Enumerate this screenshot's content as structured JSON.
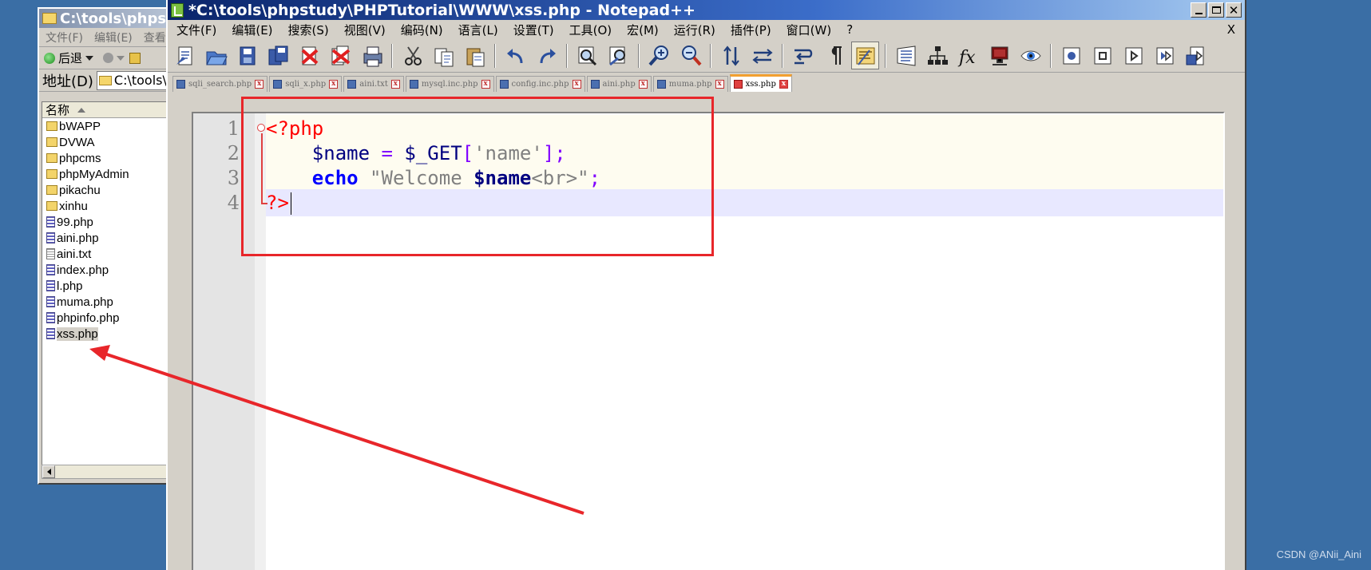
{
  "explorer": {
    "title": "C:\\tools\\phpstudy\\PHPTutorial\\WWW",
    "menu": [
      "文件(F)",
      "编辑(E)",
      "查看(V)"
    ],
    "nav": {
      "back_label": "后退"
    },
    "address": {
      "label": "地址(D)",
      "value": "C:\\tools\\phpstudy\\PHPTutorial\\WWW"
    },
    "column_header": "名称",
    "files": [
      {
        "name": "bWAPP",
        "type": "folder"
      },
      {
        "name": "DVWA",
        "type": "folder"
      },
      {
        "name": "phpcms",
        "type": "folder"
      },
      {
        "name": "phpMyAdmin",
        "type": "folder"
      },
      {
        "name": "pikachu",
        "type": "folder"
      },
      {
        "name": "xinhu",
        "type": "folder"
      },
      {
        "name": "99.php",
        "type": "php"
      },
      {
        "name": "aini.php",
        "type": "php"
      },
      {
        "name": "aini.txt",
        "type": "txt"
      },
      {
        "name": "index.php",
        "type": "php"
      },
      {
        "name": "l.php",
        "type": "php"
      },
      {
        "name": "muma.php",
        "type": "php"
      },
      {
        "name": "phpinfo.php",
        "type": "php"
      },
      {
        "name": "xss.php",
        "type": "php",
        "selected": true
      }
    ]
  },
  "notepad": {
    "title": "*C:\\tools\\phpstudy\\PHPTutorial\\WWW\\xss.php - Notepad++",
    "menu": [
      "文件(F)",
      "编辑(E)",
      "搜索(S)",
      "视图(V)",
      "编码(N)",
      "语言(L)",
      "设置(T)",
      "工具(O)",
      "宏(M)",
      "运行(R)",
      "插件(P)",
      "窗口(W)",
      "?"
    ],
    "menu_close": "X",
    "toolbar_icons": [
      "new-file-icon",
      "open-file-icon",
      "save-icon",
      "save-all-icon",
      "close-icon",
      "close-all-icon",
      "print-icon",
      "cut-icon",
      "copy-icon",
      "paste-icon",
      "undo-icon",
      "redo-icon",
      "find-icon",
      "replace-icon",
      "zoom-in-icon",
      "zoom-out-icon",
      "sync-vertical-icon",
      "sync-horizontal-icon",
      "word-wrap-icon",
      "show-all-chars-icon",
      "indent-guide-icon",
      "document-map-icon",
      "function-list-icon",
      "fx-icon",
      "monitor-icon",
      "eye-icon",
      "record-macro-icon",
      "stop-macro-icon",
      "play-macro-icon",
      "run-macro-multiple-icon",
      "save-macro-icon"
    ],
    "tabs": [
      {
        "label": "sqli_search.php",
        "active": false
      },
      {
        "label": "sqli_x.php",
        "active": false
      },
      {
        "label": "aini.txt",
        "active": false
      },
      {
        "label": "mysql.inc.php",
        "active": false
      },
      {
        "label": "config.inc.php",
        "active": false
      },
      {
        "label": "aini.php",
        "active": false
      },
      {
        "label": "muma.php",
        "active": false
      },
      {
        "label": "xss.php",
        "active": true
      }
    ],
    "code_lines": [
      {
        "num": "1",
        "tokens": [
          {
            "t": "<?php",
            "c": "tag"
          }
        ]
      },
      {
        "num": "2",
        "tokens": [
          {
            "t": "    ",
            "c": "plain"
          },
          {
            "t": "$name",
            "c": "var"
          },
          {
            "t": " ",
            "c": "plain"
          },
          {
            "t": "=",
            "c": "op"
          },
          {
            "t": " ",
            "c": "plain"
          },
          {
            "t": "$_GET",
            "c": "var"
          },
          {
            "t": "[",
            "c": "op"
          },
          {
            "t": "'name'",
            "c": "str"
          },
          {
            "t": "];",
            "c": "op"
          }
        ]
      },
      {
        "num": "3",
        "tokens": [
          {
            "t": "    ",
            "c": "plain"
          },
          {
            "t": "echo",
            "c": "kw"
          },
          {
            "t": " ",
            "c": "plain"
          },
          {
            "t": "\"Welcome ",
            "c": "str"
          },
          {
            "t": "$name",
            "c": "strvar"
          },
          {
            "t": "<br>\"",
            "c": "str"
          },
          {
            "t": ";",
            "c": "op"
          }
        ]
      },
      {
        "num": "4",
        "tokens": [
          {
            "t": "?>",
            "c": "tag"
          }
        ]
      }
    ]
  },
  "watermark": "CSDN @ANii_Aini",
  "colors": {
    "annotation": "#e8262a",
    "desktop": "#3a6ea5"
  }
}
